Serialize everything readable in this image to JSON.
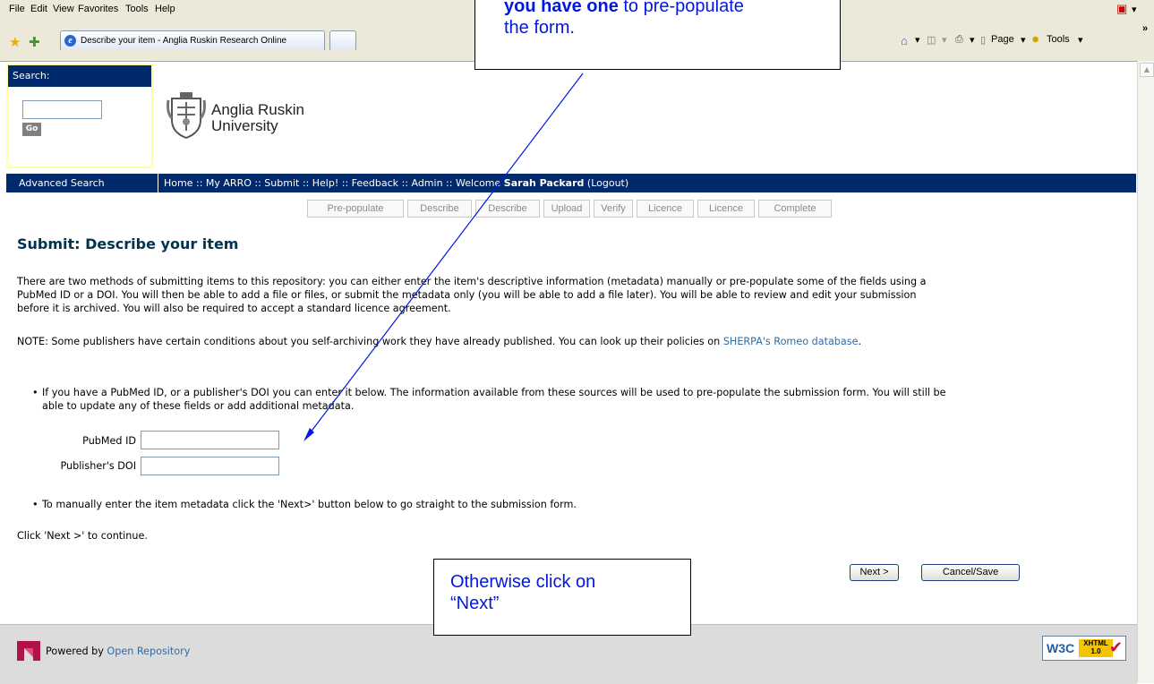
{
  "browser": {
    "menu": [
      "File",
      "Edit",
      "View",
      "Favorites",
      "Tools",
      "Help"
    ],
    "tabs": [
      "Describe your item - Anglia Ruskin Research Online",
      ""
    ],
    "toolbar": {
      "page": "Page",
      "tools": "Tools",
      "overflow": "»"
    }
  },
  "search": {
    "heading": "Search:",
    "value": "",
    "go": "Go",
    "advanced": "Advanced Search"
  },
  "logo": {
    "line1": "Anglia Ruskin",
    "line2": "University"
  },
  "nav": {
    "links": [
      "Home",
      "My ARRO",
      "Submit",
      "Help!",
      "Feedback",
      "Admin"
    ],
    "separator": "::",
    "welcome": "Welcome",
    "user": "Sarah Packard",
    "logout": "(Logout)"
  },
  "steps": [
    "Pre-populate",
    "Describe",
    "Describe",
    "Upload",
    "Verify",
    "Licence",
    "Licence",
    "Complete"
  ],
  "main": {
    "title": "Submit: Describe your item",
    "intro_lines": [
      "There are two methods of submitting items to this repository: you can either enter the item's descriptive information (metadata) manually or pre-populate some of the fields using a",
      "PubMed ID or a DOI. You will then be able to add a file or files, or submit the metadata only (you will be able to add a file later). You will be able to review and edit your submission",
      "before it is archived. You will also be required to accept a standard licence agreement."
    ],
    "note_prefix": "NOTE: Some publishers have certain conditions about you self-archiving work they have already published. You can look up their policies on ",
    "note_link": "SHERPA's Romeo database",
    "note_suffix": ".",
    "bullet1_lines": [
      "If you have a PubMed ID, or a publisher's DOI you can enter it below. The information available from these sources will be used to pre-populate the submission form. You will still be",
      "able to update any of these fields or add additional metadata."
    ],
    "pubmed_label": "PubMed ID",
    "pubmed_value": "",
    "doi_label": "Publisher's DOI",
    "doi_value": "",
    "bullet2": "To manually enter the item metadata click the 'Next>' button below to go straight to the submission form.",
    "continue": "Click 'Next >' to continue.",
    "next": "Next >",
    "cancel": "Cancel/Save"
  },
  "footer": {
    "powered": "Powered by ",
    "link": "Open Repository",
    "badge_w3c": "W3C",
    "badge_xhtml": "XHTML",
    "badge_ver": "1.0"
  },
  "callouts": {
    "top_bold": "you have one",
    "top_rest": " to pre-populate",
    "top_line2": "the form.",
    "bottom_line1": "Otherwise click on",
    "bottom_line2": "“Next”"
  },
  "colors": {
    "accent_navy": "#002a6c",
    "callout_text": "#0018e0",
    "arrow": "#0018e0",
    "link": "#2e6da4",
    "search_frame": "#ffffa8"
  }
}
